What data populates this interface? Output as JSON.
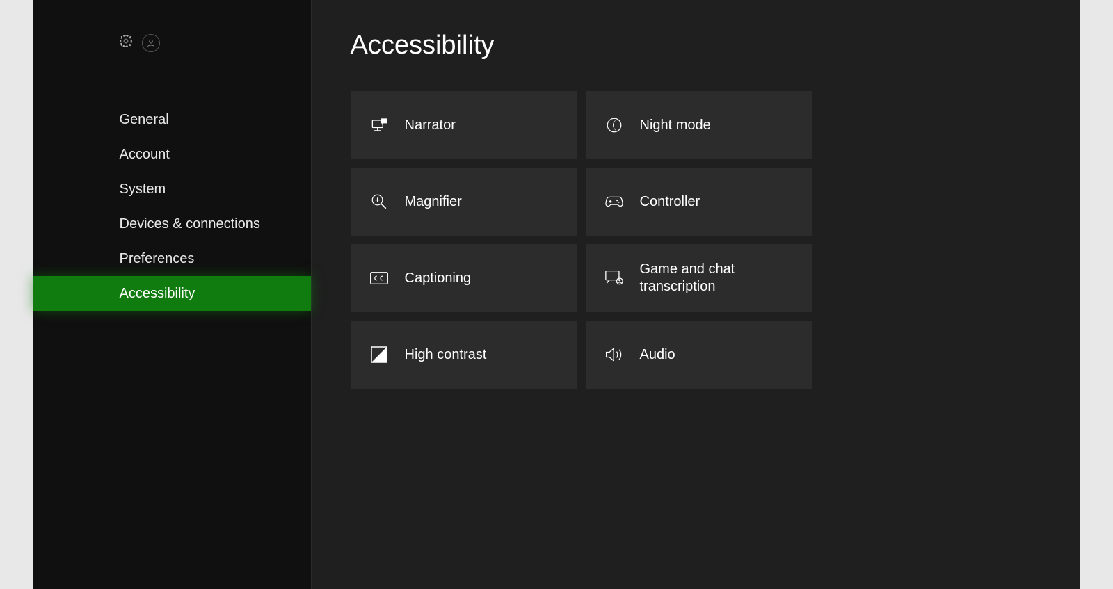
{
  "header": {
    "title": "Accessibility"
  },
  "sidebar": {
    "items": [
      {
        "id": "general",
        "label": "General",
        "active": false
      },
      {
        "id": "account",
        "label": "Account",
        "active": false
      },
      {
        "id": "system",
        "label": "System",
        "active": false
      },
      {
        "id": "devices",
        "label": "Devices & connections",
        "active": false
      },
      {
        "id": "preferences",
        "label": "Preferences",
        "active": false
      },
      {
        "id": "accessibility",
        "label": "Accessibility",
        "active": true
      }
    ]
  },
  "tiles": [
    {
      "id": "narrator",
      "label": "Narrator",
      "icon": "narrator-icon"
    },
    {
      "id": "night-mode",
      "label": "Night mode",
      "icon": "night-mode-icon"
    },
    {
      "id": "magnifier",
      "label": "Magnifier",
      "icon": "magnifier-icon"
    },
    {
      "id": "controller",
      "label": "Controller",
      "icon": "controller-icon"
    },
    {
      "id": "captioning",
      "label": "Captioning",
      "icon": "captioning-icon"
    },
    {
      "id": "transcription",
      "label": "Game and chat transcription",
      "icon": "transcription-icon"
    },
    {
      "id": "high-contrast",
      "label": "High contrast",
      "icon": "high-contrast-icon"
    },
    {
      "id": "audio",
      "label": "Audio",
      "icon": "audio-icon"
    }
  ]
}
